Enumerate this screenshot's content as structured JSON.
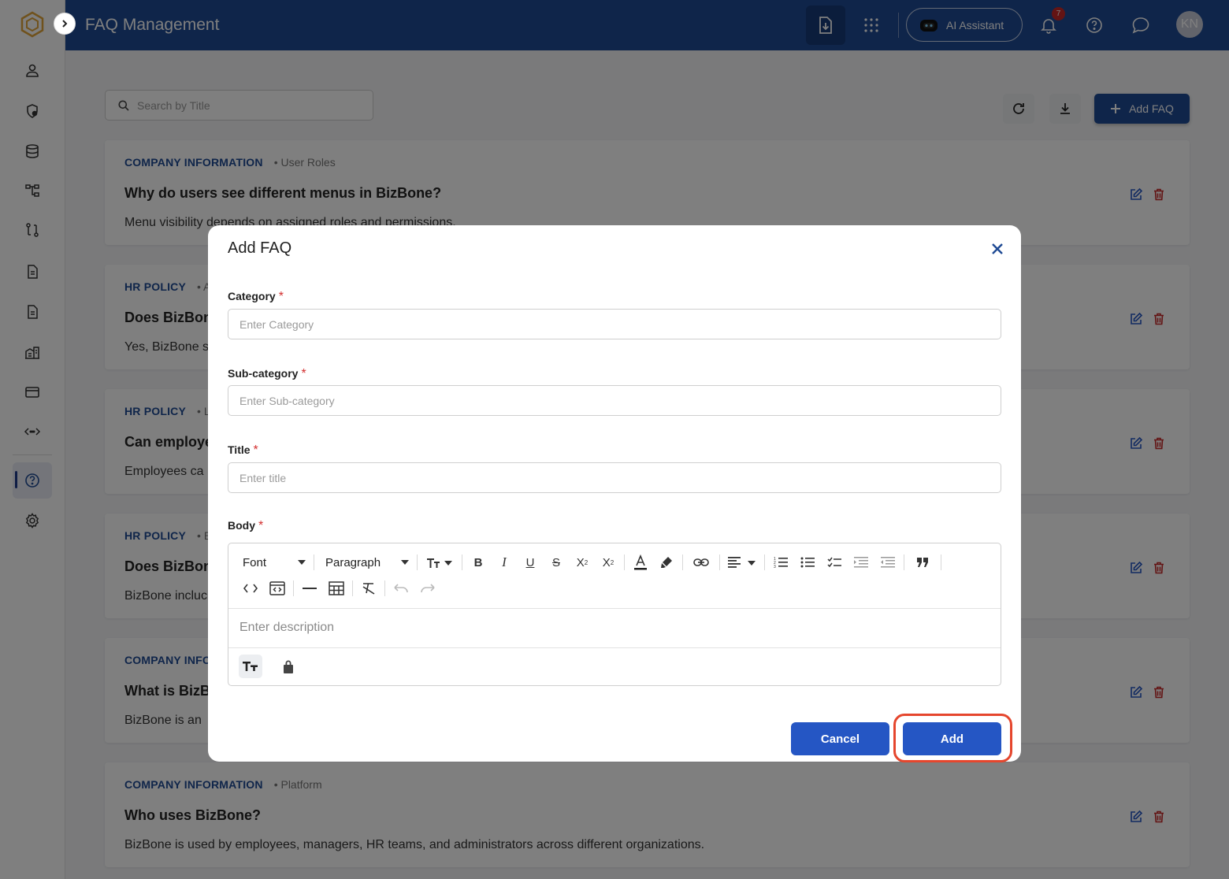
{
  "header": {
    "title": "FAQ Management",
    "ai_label": "AI Assistant",
    "notifications": "7",
    "avatar": "KN"
  },
  "toolbar": {
    "search_placeholder": "Search by Title",
    "add_label": "Add FAQ"
  },
  "faqs": [
    {
      "category": "COMPANY INFORMATION",
      "subcategory": "• User Roles",
      "title": "Why do users see different menus in BizBone?",
      "body": "Menu visibility depends on assigned roles and permissions."
    },
    {
      "category": "HR POLICY",
      "subcategory": "• A",
      "title": "Does BizBon",
      "body": "Yes, BizBone s"
    },
    {
      "category": "HR POLICY",
      "subcategory": "• L",
      "title": "Can employe",
      "body": "Employees ca"
    },
    {
      "category": "HR POLICY",
      "subcategory": "• E",
      "title": "Does BizBon",
      "body": "BizBone incluc"
    },
    {
      "category": "COMPANY INFO",
      "subcategory": "",
      "title": "What is BizB",
      "body": "BizBone is an"
    },
    {
      "category": "COMPANY INFORMATION",
      "subcategory": "• Platform",
      "title": "Who uses BizBone?",
      "body": "BizBone is used by employees, managers, HR teams, and administrators across different organizations."
    }
  ],
  "modal": {
    "title": "Add FAQ",
    "category_label": "Category",
    "category_placeholder": "Enter Category",
    "subcategory_label": "Sub-category",
    "subcategory_placeholder": "Enter Sub-category",
    "title_label": "Title",
    "title_placeholder": "Enter title",
    "body_label": "Body",
    "required_mark": "*",
    "font_select": "Font",
    "paragraph_select": "Paragraph",
    "body_placeholder": "Enter description",
    "cancel_label": "Cancel",
    "add_label": "Add"
  },
  "colors": {
    "brand": "#1f4a94",
    "primary_button": "#2556c4",
    "delete": "#c62828",
    "highlight": "#e5462d"
  }
}
